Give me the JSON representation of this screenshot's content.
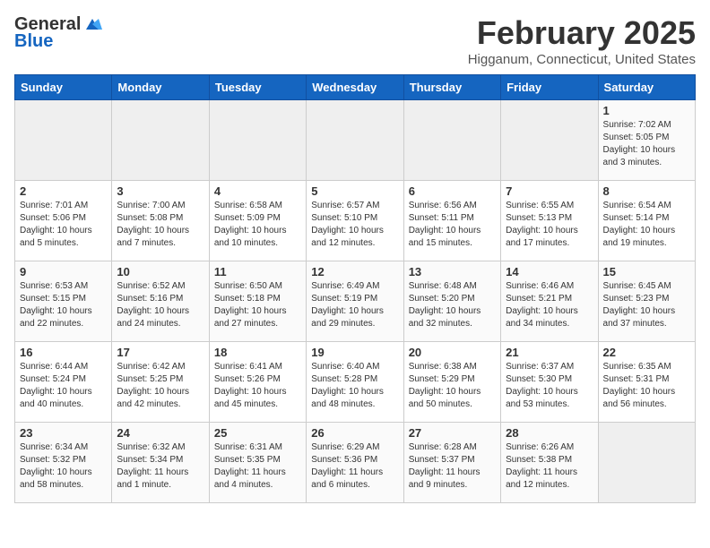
{
  "header": {
    "logo_general": "General",
    "logo_blue": "Blue",
    "month_title": "February 2025",
    "location": "Higganum, Connecticut, United States"
  },
  "weekdays": [
    "Sunday",
    "Monday",
    "Tuesday",
    "Wednesday",
    "Thursday",
    "Friday",
    "Saturday"
  ],
  "weeks": [
    [
      {
        "day": "",
        "empty": true
      },
      {
        "day": "",
        "empty": true
      },
      {
        "day": "",
        "empty": true
      },
      {
        "day": "",
        "empty": true
      },
      {
        "day": "",
        "empty": true
      },
      {
        "day": "",
        "empty": true
      },
      {
        "day": "1",
        "info": "Sunrise: 7:02 AM\nSunset: 5:05 PM\nDaylight: 10 hours and 3 minutes."
      }
    ],
    [
      {
        "day": "2",
        "info": "Sunrise: 7:01 AM\nSunset: 5:06 PM\nDaylight: 10 hours and 5 minutes."
      },
      {
        "day": "3",
        "info": "Sunrise: 7:00 AM\nSunset: 5:08 PM\nDaylight: 10 hours and 7 minutes."
      },
      {
        "day": "4",
        "info": "Sunrise: 6:58 AM\nSunset: 5:09 PM\nDaylight: 10 hours and 10 minutes."
      },
      {
        "day": "5",
        "info": "Sunrise: 6:57 AM\nSunset: 5:10 PM\nDaylight: 10 hours and 12 minutes."
      },
      {
        "day": "6",
        "info": "Sunrise: 6:56 AM\nSunset: 5:11 PM\nDaylight: 10 hours and 15 minutes."
      },
      {
        "day": "7",
        "info": "Sunrise: 6:55 AM\nSunset: 5:13 PM\nDaylight: 10 hours and 17 minutes."
      },
      {
        "day": "8",
        "info": "Sunrise: 6:54 AM\nSunset: 5:14 PM\nDaylight: 10 hours and 19 minutes."
      }
    ],
    [
      {
        "day": "9",
        "info": "Sunrise: 6:53 AM\nSunset: 5:15 PM\nDaylight: 10 hours and 22 minutes."
      },
      {
        "day": "10",
        "info": "Sunrise: 6:52 AM\nSunset: 5:16 PM\nDaylight: 10 hours and 24 minutes."
      },
      {
        "day": "11",
        "info": "Sunrise: 6:50 AM\nSunset: 5:18 PM\nDaylight: 10 hours and 27 minutes."
      },
      {
        "day": "12",
        "info": "Sunrise: 6:49 AM\nSunset: 5:19 PM\nDaylight: 10 hours and 29 minutes."
      },
      {
        "day": "13",
        "info": "Sunrise: 6:48 AM\nSunset: 5:20 PM\nDaylight: 10 hours and 32 minutes."
      },
      {
        "day": "14",
        "info": "Sunrise: 6:46 AM\nSunset: 5:21 PM\nDaylight: 10 hours and 34 minutes."
      },
      {
        "day": "15",
        "info": "Sunrise: 6:45 AM\nSunset: 5:23 PM\nDaylight: 10 hours and 37 minutes."
      }
    ],
    [
      {
        "day": "16",
        "info": "Sunrise: 6:44 AM\nSunset: 5:24 PM\nDaylight: 10 hours and 40 minutes."
      },
      {
        "day": "17",
        "info": "Sunrise: 6:42 AM\nSunset: 5:25 PM\nDaylight: 10 hours and 42 minutes."
      },
      {
        "day": "18",
        "info": "Sunrise: 6:41 AM\nSunset: 5:26 PM\nDaylight: 10 hours and 45 minutes."
      },
      {
        "day": "19",
        "info": "Sunrise: 6:40 AM\nSunset: 5:28 PM\nDaylight: 10 hours and 48 minutes."
      },
      {
        "day": "20",
        "info": "Sunrise: 6:38 AM\nSunset: 5:29 PM\nDaylight: 10 hours and 50 minutes."
      },
      {
        "day": "21",
        "info": "Sunrise: 6:37 AM\nSunset: 5:30 PM\nDaylight: 10 hours and 53 minutes."
      },
      {
        "day": "22",
        "info": "Sunrise: 6:35 AM\nSunset: 5:31 PM\nDaylight: 10 hours and 56 minutes."
      }
    ],
    [
      {
        "day": "23",
        "info": "Sunrise: 6:34 AM\nSunset: 5:32 PM\nDaylight: 10 hours and 58 minutes."
      },
      {
        "day": "24",
        "info": "Sunrise: 6:32 AM\nSunset: 5:34 PM\nDaylight: 11 hours and 1 minute."
      },
      {
        "day": "25",
        "info": "Sunrise: 6:31 AM\nSunset: 5:35 PM\nDaylight: 11 hours and 4 minutes."
      },
      {
        "day": "26",
        "info": "Sunrise: 6:29 AM\nSunset: 5:36 PM\nDaylight: 11 hours and 6 minutes."
      },
      {
        "day": "27",
        "info": "Sunrise: 6:28 AM\nSunset: 5:37 PM\nDaylight: 11 hours and 9 minutes."
      },
      {
        "day": "28",
        "info": "Sunrise: 6:26 AM\nSunset: 5:38 PM\nDaylight: 11 hours and 12 minutes."
      },
      {
        "day": "",
        "empty": true
      }
    ]
  ]
}
